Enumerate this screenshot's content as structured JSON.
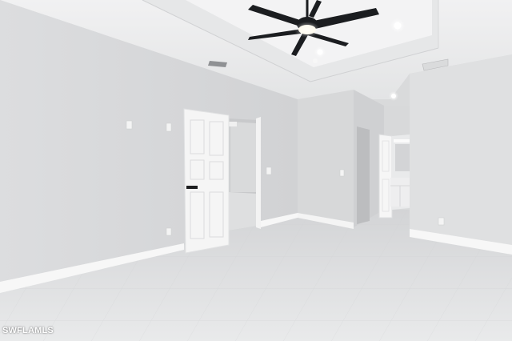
{
  "watermark": {
    "text": "SWFLAMLS"
  },
  "palette": {
    "wall_light": "#e4e5e6",
    "wall_mid": "#d6d7d8",
    "ceiling": "#eeeeef",
    "floor": "#e2e3e4",
    "trim": "#f7f7f7",
    "door": "#f5f5f5",
    "fan": "#1b1d20",
    "light_glow": "#fffdf5"
  },
  "objects": [
    {
      "name": "ceiling-fan",
      "count": 1,
      "blades": 4
    },
    {
      "name": "recessed-light",
      "count": 4
    },
    {
      "name": "hvac-vent",
      "count": 2
    },
    {
      "name": "interior-door-open",
      "count": 2
    },
    {
      "name": "doorway",
      "count": 3
    },
    {
      "name": "electrical-outlet",
      "count": 3
    },
    {
      "name": "light-switch",
      "count": 2
    },
    {
      "name": "tile-floor",
      "count": 1
    }
  ]
}
